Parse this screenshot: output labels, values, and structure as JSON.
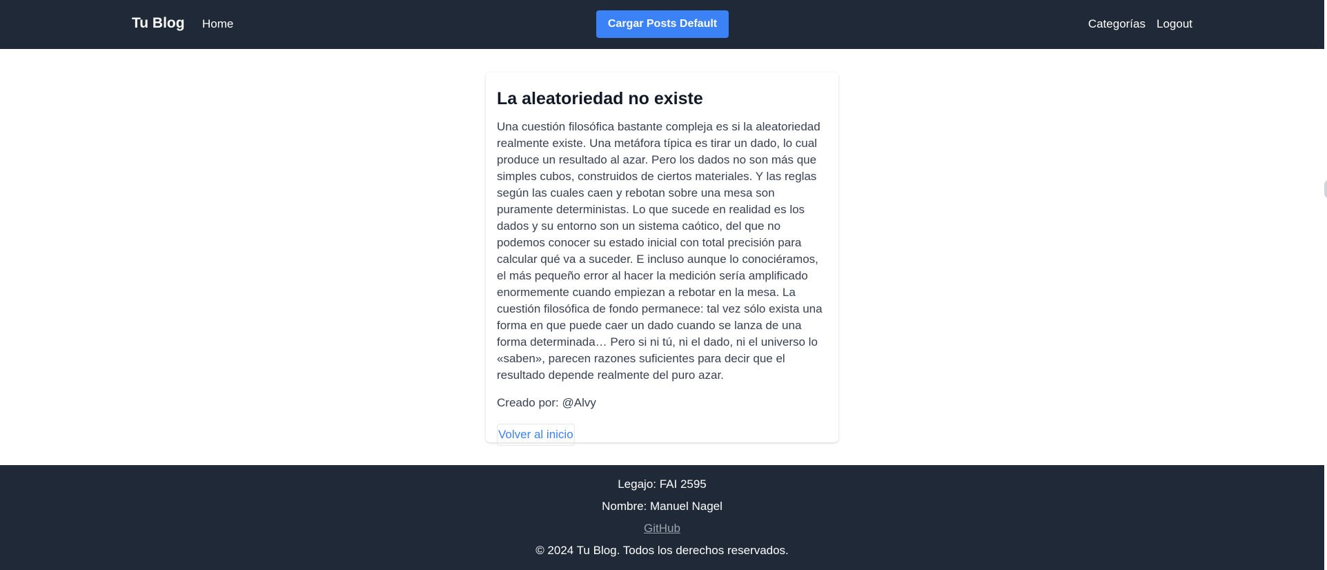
{
  "header": {
    "brand": "Tu Blog",
    "home_label": "Home",
    "load_button_label": "Cargar Posts Default",
    "categories_label": "Categorías",
    "logout_label": "Logout"
  },
  "post": {
    "title": "La aleatoriedad no existe",
    "body": "Una cuestión filosófica bastante compleja es si la aleatoriedad realmente existe. Una metáfora típica es tirar un dado, lo cual produce un resultado al azar. Pero los dados no son más que simples cubos, construidos de ciertos materiales. Y las reglas según las cuales caen y rebotan sobre una mesa son puramente deterministas. Lo que sucede en realidad es los dados y su entorno son un sistema caótico, del que no podemos conocer su estado inicial con total precisión para calcular qué va a suceder. E incluso aunque lo conociéramos, el más pequeño error al hacer la medición sería amplificado enormemente cuando empiezan a rebotar en la mesa. La cuestión filosófica de fondo permanece: tal vez sólo exista una forma en que puede caer un dado cuando se lanza de una forma determinada… Pero si ni tú, ni el dado, ni el universo lo «saben», parecen razones suficientes para decir que el resultado depende realmente del puro azar.",
    "author": "Creado por: @Alvy",
    "back_label": "Volver al inicio"
  },
  "footer": {
    "legajo": "Legajo: FAI 2595",
    "nombre": "Nombre: Manuel Nagel",
    "github_label": "GitHub",
    "copyright": "© 2024 Tu Blog. Todos los derechos reservados."
  },
  "colors": {
    "nav_bg": "#1f2937",
    "accent": "#3b82f6",
    "text": "#374151"
  }
}
